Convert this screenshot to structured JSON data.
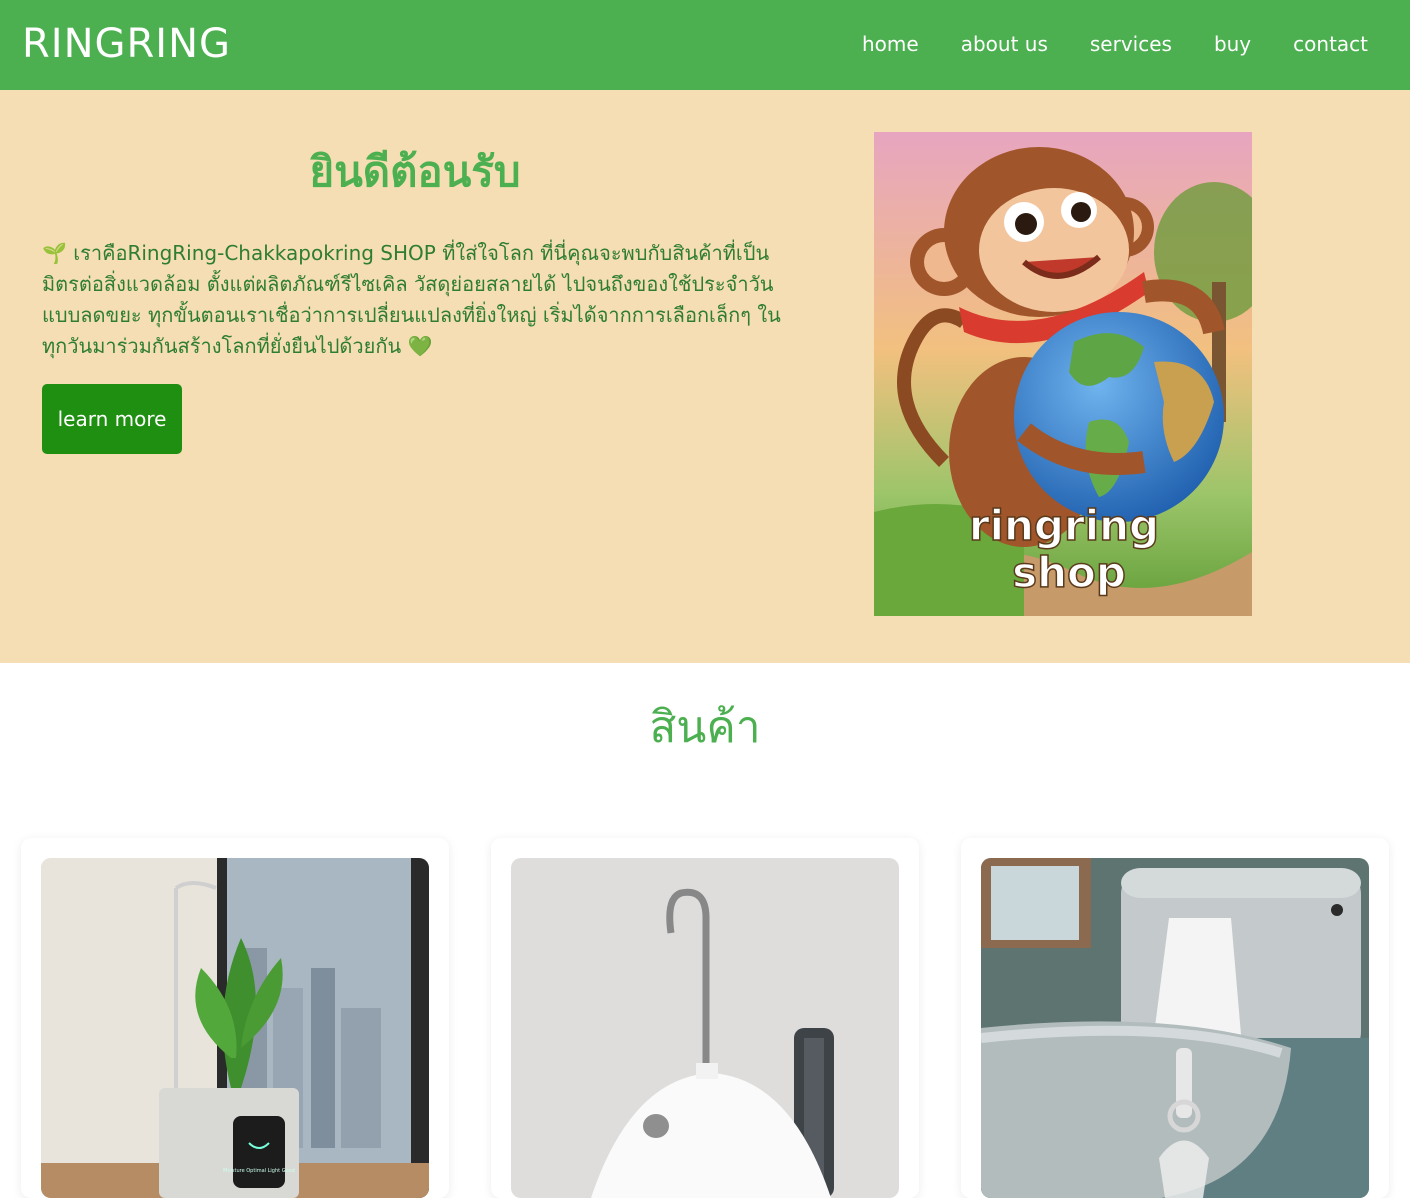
{
  "header": {
    "brand": "RINGRING",
    "nav": [
      "home",
      "about us",
      "services",
      "buy",
      "contact"
    ]
  },
  "hero": {
    "title": "ยินดีต้อนรับ",
    "description": "🌱 เราคือRingRing-Chakkapokring SHOP ที่ใส่ใจโลก ที่นี่คุณจะพบกับสินค้าที่เป็นมิตรต่อสิ่งแวดล้อม ตั้งแต่ผลิตภัณฑ์รีไซเคิล วัสดุย่อยสลายได้ ไปจนถึงของใช้ประจำวันแบบลดขยะ ทุกขั้นตอนเราเชื่อว่าการเปลี่ยนแปลงที่ยิ่งใหญ่ เริ่มได้จากการเลือกเล็กๆ ในทุกวันมาร่วมกันสร้างโลกที่ยั่งยืนไปด้วยกัน 💚",
    "button": "learn more",
    "image_text_line1": "ringring",
    "image_text_line2": "shop"
  },
  "products": {
    "title": "สินค้า",
    "items": [
      {
        "image": "smart-planter-photo",
        "screen_text": "Moisture Optimal Light Good"
      },
      {
        "image": "hook-dispenser-photo"
      },
      {
        "image": "toilet-bag-holder-photo"
      }
    ]
  },
  "colors": {
    "primary": "#4caf50",
    "hero_bg": "#f5deb3",
    "button": "#1e8f10",
    "hero_text": "#2e7d32"
  }
}
